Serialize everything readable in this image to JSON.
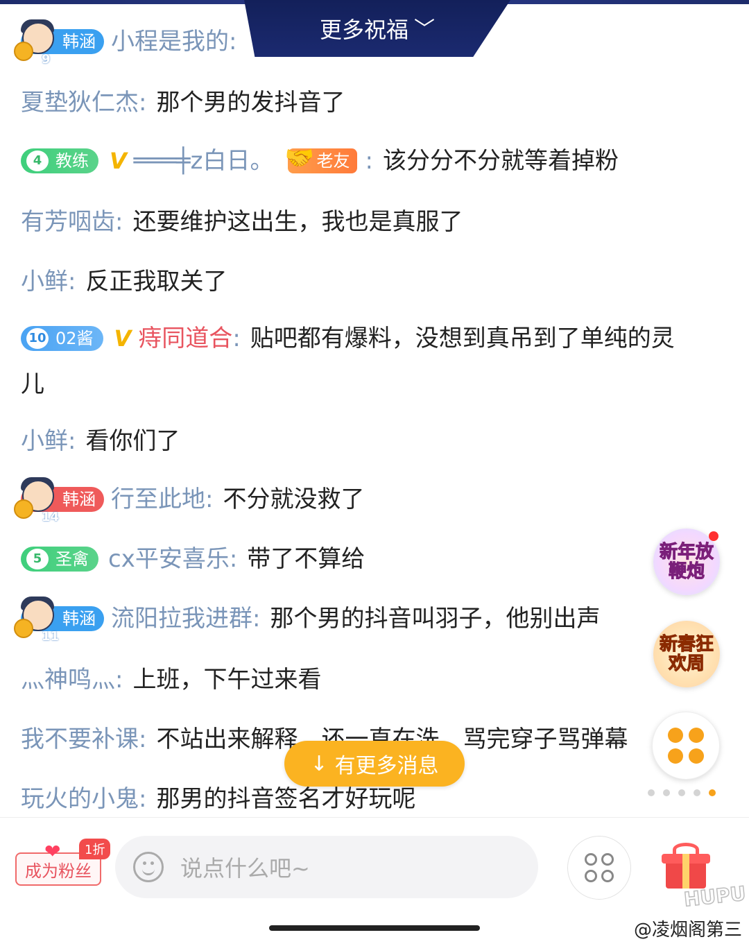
{
  "header": {
    "blessing_label": "更多祝福",
    "chevron_icon": "chevron-down-icon"
  },
  "messages": [
    {
      "badge_level": "9",
      "badge_label": "韩涵",
      "name": "小程是我的",
      "sep": ":",
      "text": ""
    },
    {
      "name": "夏垫狄仁杰",
      "sep": ":",
      "text": "那个男的发抖音了"
    },
    {
      "heart_level": "4",
      "badge_label": "教练",
      "name": "═══╪z白日。",
      "friend_badge": "老友",
      "sep": ":",
      "text": "该分分不分就等着掉粉"
    },
    {
      "name": "有芳咽齿",
      "sep": ":",
      "text": "还要维护这出生，我也是真服了"
    },
    {
      "name": "小鲜",
      "sep": ":",
      "text": "反正我取关了"
    },
    {
      "heart_level": "10",
      "badge_label": "02酱",
      "name": "痔同道合",
      "sep": ":",
      "text": "贴吧都有爆料，没想到真吊到了单纯的灵",
      "text_cont": "儿"
    },
    {
      "name": "小鲜",
      "sep": ":",
      "text": "看你们了"
    },
    {
      "badge_level": "14",
      "badge_label": "韩涵",
      "name": "行至此地",
      "sep": ":",
      "text": "不分就没救了"
    },
    {
      "heart_level": "5",
      "badge_label": "圣禽",
      "name": "cx平安喜乐",
      "sep": ":",
      "text": "带了不算给"
    },
    {
      "badge_level": "11",
      "badge_label": "韩涵",
      "name": "流阳拉我进群",
      "sep": ":",
      "text": "那个男的抖音叫羽子，他别出声"
    },
    {
      "name": "灬神鸣灬",
      "sep": ":",
      "text": "上班，下午过来看"
    },
    {
      "name": "我不要补课",
      "sep": ":",
      "text": "不站出来解释，还一直在洗，骂完穿子骂弹幕"
    },
    {
      "name": "玩火的小鬼",
      "sep": ":",
      "text": "那男的抖音签名才好玩呢"
    }
  ],
  "side": {
    "firecracker_label": "新年放鞭炮",
    "carnival_label": "新春狂欢周"
  },
  "more_messages_label": "有更多消息",
  "bottom": {
    "fan_button_label": "成为粉丝",
    "discount_label": "1折",
    "input_placeholder": "说点什么吧~"
  },
  "watermarks": {
    "hupu": "HUPU",
    "weibo": "@凌烟阁第三"
  },
  "colors": {
    "name_color": "#7a95b8",
    "accent_orange": "#fbb321",
    "badge_blue": "#3aa0f0",
    "badge_green": "#3fcf7c",
    "fan_red": "#e8545f"
  }
}
